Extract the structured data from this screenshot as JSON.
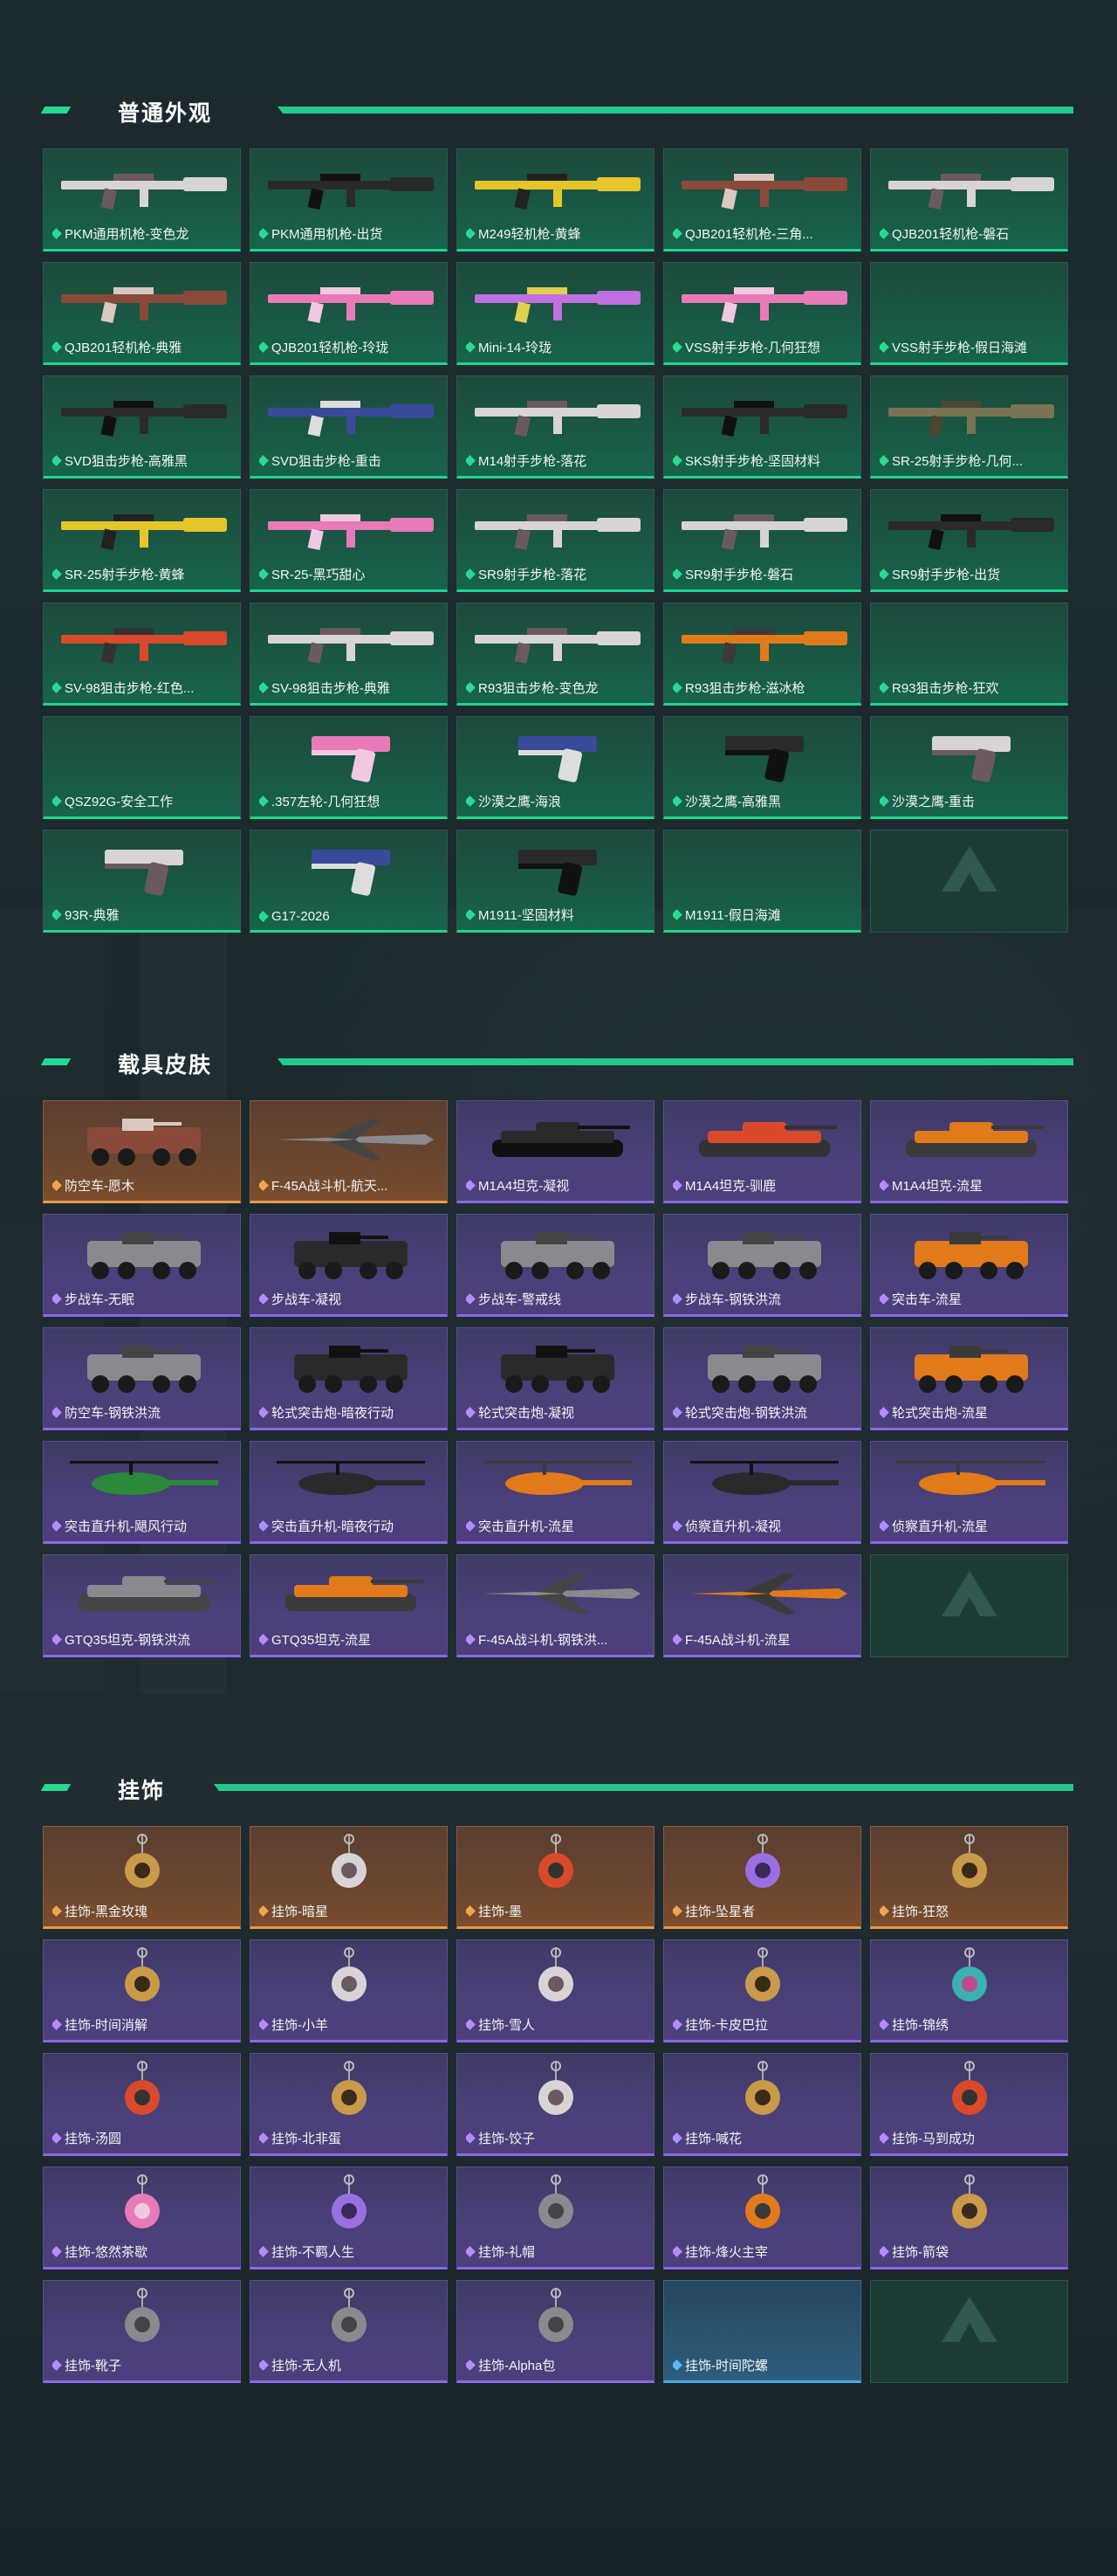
{
  "colors": {
    "accent": "#22c98b",
    "green_card": "#1a5744",
    "purple_card": "#4b4079",
    "orange_card": "#6b4630",
    "blue_card": "#2a5470"
  },
  "sections": [
    {
      "title": "普通外观",
      "items": [
        {
          "label": "PKM通用机枪-变色龙",
          "rarity": "green",
          "art": "rifle-white"
        },
        {
          "label": "PKM通用机枪-出货",
          "rarity": "green",
          "art": "rifle-dark"
        },
        {
          "label": "M249轻机枪-黄蜂",
          "rarity": "green",
          "art": "rifle-yellow"
        },
        {
          "label": "QJB201轻机枪-三角...",
          "rarity": "green",
          "art": "rifle-rust"
        },
        {
          "label": "QJB201轻机枪-磐石",
          "rarity": "green",
          "art": "rifle-white"
        },
        {
          "label": "QJB201轻机枪-典雅",
          "rarity": "green",
          "art": "rifle-rust"
        },
        {
          "label": "QJB201轻机枪-玲珑",
          "rarity": "green",
          "art": "rifle-pink"
        },
        {
          "label": "Mini-14-玲珑",
          "rarity": "green",
          "art": "rifle-rainbow"
        },
        {
          "label": "VSS射手步枪-几何狂想",
          "rarity": "green",
          "art": "rifle-pink"
        },
        {
          "label": "VSS射手步枪-假日海滩",
          "rarity": "green",
          "art": "none"
        },
        {
          "label": "SVD狙击步枪-高雅黑",
          "rarity": "green",
          "art": "rifle-dark"
        },
        {
          "label": "SVD狙击步枪-重击",
          "rarity": "green",
          "art": "rifle-blue"
        },
        {
          "label": "M14射手步枪-落花",
          "rarity": "green",
          "art": "rifle-white"
        },
        {
          "label": "SKS射手步枪-坚固材料",
          "rarity": "green",
          "art": "rifle-dark"
        },
        {
          "label": "SR-25射手步枪-几何...",
          "rarity": "green",
          "art": "rifle-camo"
        },
        {
          "label": "SR-25射手步枪-黄蜂",
          "rarity": "green",
          "art": "rifle-yellow"
        },
        {
          "label": "SR-25-黑巧甜心",
          "rarity": "green",
          "art": "rifle-pink"
        },
        {
          "label": "SR9射手步枪-落花",
          "rarity": "green",
          "art": "rifle-white"
        },
        {
          "label": "SR9射手步枪-磐石",
          "rarity": "green",
          "art": "rifle-white"
        },
        {
          "label": "SR9射手步枪-出货",
          "rarity": "green",
          "art": "rifle-dark"
        },
        {
          "label": "SV-98狙击步枪-红色...",
          "rarity": "green",
          "art": "rifle-red"
        },
        {
          "label": "SV-98狙击步枪-典雅",
          "rarity": "green",
          "art": "rifle-white"
        },
        {
          "label": "R93狙击步枪-变色龙",
          "rarity": "green",
          "art": "rifle-white"
        },
        {
          "label": "R93狙击步枪-滋冰枪",
          "rarity": "green",
          "art": "rifle-orange"
        },
        {
          "label": "R93狙击步枪-狂欢",
          "rarity": "green",
          "art": "none"
        },
        {
          "label": "QSZ92G-安全工作",
          "rarity": "green",
          "art": "none"
        },
        {
          "label": ".357左轮-几何狂想",
          "rarity": "green",
          "art": "pistol-pink"
        },
        {
          "label": "沙漠之鹰-海浪",
          "rarity": "green",
          "art": "pistol-blue"
        },
        {
          "label": "沙漠之鹰-高雅黑",
          "rarity": "green",
          "art": "pistol-dark"
        },
        {
          "label": "沙漠之鹰-重击",
          "rarity": "green",
          "art": "pistol-white"
        },
        {
          "label": "93R-典雅",
          "rarity": "green",
          "art": "pistol-white"
        },
        {
          "label": "G17-2026",
          "rarity": "green",
          "art": "pistol-blue"
        },
        {
          "label": "M1911-坚固材料",
          "rarity": "green",
          "art": "pistol-dark"
        },
        {
          "label": "M1911-假日海滩",
          "rarity": "green",
          "art": "none"
        },
        {
          "label": "",
          "rarity": "empty",
          "art": "logo"
        }
      ]
    },
    {
      "title": "载具皮肤",
      "items": [
        {
          "label": "防空车-愿木",
          "rarity": "orange",
          "art": "apc-rust"
        },
        {
          "label": "F-45A战斗机-航天...",
          "rarity": "orange",
          "art": "jet-grey"
        },
        {
          "label": "M1A4坦克-凝视",
          "rarity": "purple",
          "art": "tank-dark"
        },
        {
          "label": "M1A4坦克-驯鹿",
          "rarity": "purple",
          "art": "tank-red"
        },
        {
          "label": "M1A4坦克-流星",
          "rarity": "purple",
          "art": "tank-orange"
        },
        {
          "label": "步战车-无眠",
          "rarity": "purple",
          "art": "apc-grey"
        },
        {
          "label": "步战车-凝视",
          "rarity": "purple",
          "art": "apc-dark"
        },
        {
          "label": "步战车-警戒线",
          "rarity": "purple",
          "art": "apc-grey"
        },
        {
          "label": "步战车-钢铁洪流",
          "rarity": "purple",
          "art": "apc-grey"
        },
        {
          "label": "突击车-流星",
          "rarity": "purple",
          "art": "truck-orange"
        },
        {
          "label": "防空车-钢铁洪流",
          "rarity": "purple",
          "art": "apc-grey"
        },
        {
          "label": "轮式突击炮-暗夜行动",
          "rarity": "purple",
          "art": "apc-dark"
        },
        {
          "label": "轮式突击炮-凝视",
          "rarity": "purple",
          "art": "apc-dark"
        },
        {
          "label": "轮式突击炮-钢铁洪流",
          "rarity": "purple",
          "art": "apc-grey"
        },
        {
          "label": "轮式突击炮-流星",
          "rarity": "purple",
          "art": "apc-orange"
        },
        {
          "label": "突击直升机-飓风行动",
          "rarity": "purple",
          "art": "heli-green"
        },
        {
          "label": "突击直升机-暗夜行动",
          "rarity": "purple",
          "art": "heli-dark"
        },
        {
          "label": "突击直升机-流星",
          "rarity": "purple",
          "art": "heli-orange"
        },
        {
          "label": "侦察直升机-凝视",
          "rarity": "purple",
          "art": "heli-dark"
        },
        {
          "label": "侦察直升机-流星",
          "rarity": "purple",
          "art": "heli-orange"
        },
        {
          "label": "GTQ35坦克-钢铁洪流",
          "rarity": "purple",
          "art": "tank-grey"
        },
        {
          "label": "GTQ35坦克-流星",
          "rarity": "purple",
          "art": "tank-orange"
        },
        {
          "label": "F-45A战斗机-钢铁洪...",
          "rarity": "purple",
          "art": "jet-grey"
        },
        {
          "label": "F-45A战斗机-流星",
          "rarity": "purple",
          "art": "jet-orange"
        },
        {
          "label": "",
          "rarity": "empty",
          "art": "logo"
        }
      ]
    },
    {
      "title": "挂饰",
      "items": [
        {
          "label": "挂饰-黑金玫瑰",
          "rarity": "orange",
          "art": "charm-gold"
        },
        {
          "label": "挂饰-暗星",
          "rarity": "orange",
          "art": "charm-white"
        },
        {
          "label": "挂饰-墨",
          "rarity": "orange",
          "art": "charm-red"
        },
        {
          "label": "挂饰-坠星者",
          "rarity": "orange",
          "art": "charm-purple"
        },
        {
          "label": "挂饰-狂怒",
          "rarity": "orange",
          "art": "charm-gold"
        },
        {
          "label": "挂饰-时间消解",
          "rarity": "purple",
          "art": "charm-gold"
        },
        {
          "label": "挂饰-小羊",
          "rarity": "purple",
          "art": "charm-white"
        },
        {
          "label": "挂饰-雪人",
          "rarity": "purple",
          "art": "charm-white"
        },
        {
          "label": "挂饰-卡皮巴拉",
          "rarity": "purple",
          "art": "charm-gold"
        },
        {
          "label": "挂饰-锦绣",
          "rarity": "purple",
          "art": "charm-teal"
        },
        {
          "label": "挂饰-汤圆",
          "rarity": "purple",
          "art": "charm-red"
        },
        {
          "label": "挂饰-北非蛋",
          "rarity": "purple",
          "art": "charm-gold"
        },
        {
          "label": "挂饰-饺子",
          "rarity": "purple",
          "art": "charm-white"
        },
        {
          "label": "挂饰-喊花",
          "rarity": "purple",
          "art": "charm-gold"
        },
        {
          "label": "挂饰-马到成功",
          "rarity": "purple",
          "art": "charm-red"
        },
        {
          "label": "挂饰-悠然茶歇",
          "rarity": "purple",
          "art": "charm-pink"
        },
        {
          "label": "挂饰-不羁人生",
          "rarity": "purple",
          "art": "charm-purple"
        },
        {
          "label": "挂饰-礼帽",
          "rarity": "purple",
          "art": "charm-grey"
        },
        {
          "label": "挂饰-烽火主宰",
          "rarity": "purple",
          "art": "charm-orange"
        },
        {
          "label": "挂饰-箭袋",
          "rarity": "purple",
          "art": "charm-gold"
        },
        {
          "label": "挂饰-靴子",
          "rarity": "purple",
          "art": "charm-grey"
        },
        {
          "label": "挂饰-无人机",
          "rarity": "purple",
          "art": "charm-grey"
        },
        {
          "label": "挂饰-Alpha包",
          "rarity": "purple",
          "art": "charm-grey"
        },
        {
          "label": "挂饰-时间陀螺",
          "rarity": "blue",
          "art": "none"
        },
        {
          "label": "",
          "rarity": "empty",
          "art": "logo"
        }
      ]
    }
  ]
}
